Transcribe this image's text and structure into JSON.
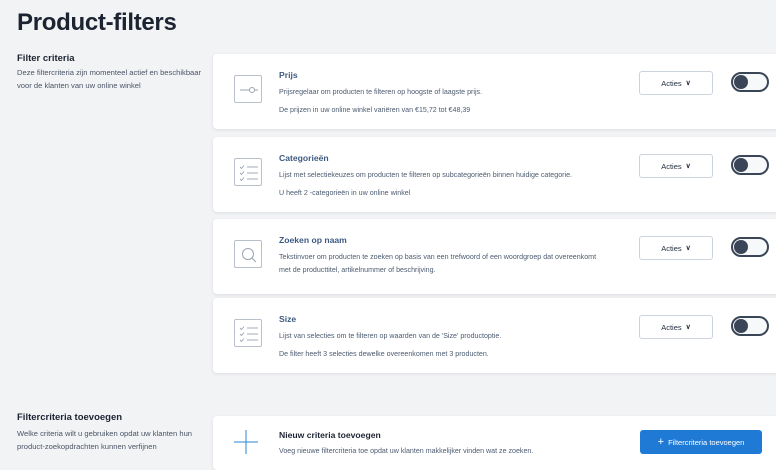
{
  "page": {
    "title": "Product-filters"
  },
  "filter_section": {
    "title": "Filter criteria",
    "description": "Deze filtercriteria zijn momenteel actief en beschikbaar voor de klanten van uw online winkel"
  },
  "filters": [
    {
      "icon": "slider-icon",
      "title": "Prijs",
      "description": "Prijsregelaar om producten te filteren op hoogste of laagste prijs.",
      "detail": "De prijzen in uw online winkel variëren van €15,72 tot €48,39",
      "actions_label": "Acties",
      "enabled": false
    },
    {
      "icon": "checklist-icon",
      "title": "Categorieën",
      "description": "Lijst met selectiekeuzes om producten te filteren op subcategorieën binnen huidige categorie.",
      "detail": "U heeft 2 -categorieën in uw online winkel",
      "actions_label": "Acties",
      "enabled": false
    },
    {
      "icon": "search-icon",
      "title": "Zoeken op naam",
      "description": "Tekstinvoer om producten te zoeken op basis van een trefwoord of een woordgroep dat overeenkomt met de producttitel, artikelnummer of beschrijving.",
      "detail": "",
      "actions_label": "Acties",
      "enabled": false
    },
    {
      "icon": "checklist-icon",
      "title": "Size",
      "description": "Lijst van selecties om te filteren op waarden van de 'Size' productoptie.",
      "detail": "De filter heeft 3 selecties dewelke overeenkomen met 3 producten.",
      "actions_label": "Acties",
      "enabled": false
    }
  ],
  "add_section": {
    "title": "Filtercriteria toevoegen",
    "description": "Welke criteria wilt u gebruiken opdat uw klanten hun product-zoekopdrachten kunnen verfijnen"
  },
  "add_card": {
    "title": "Nieuw criteria toevoegen",
    "description": "Voeg nieuwe filtercriteria toe opdat uw klanten makkelijker vinden wat ze zoeken.",
    "button_label": "Filtercriteria toevoegen"
  },
  "colors": {
    "accent": "#1f7ad6",
    "title_link": "#3d5a82",
    "background": "#f2f3f5"
  }
}
